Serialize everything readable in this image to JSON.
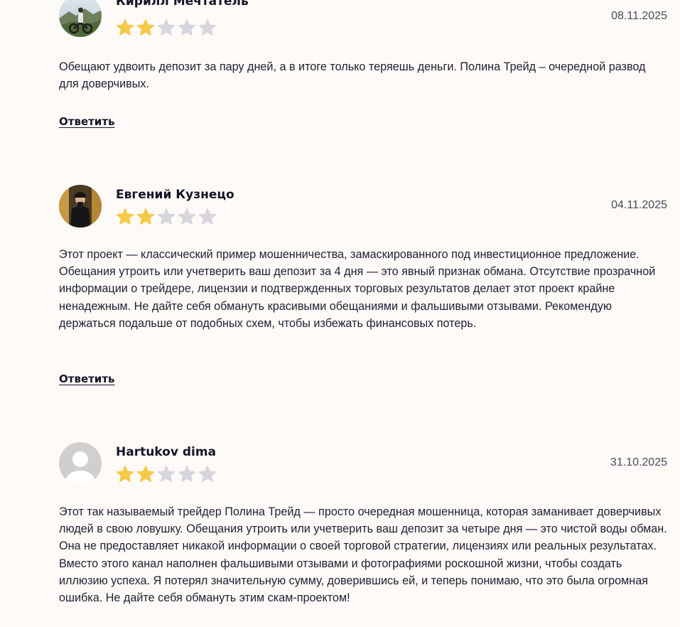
{
  "reviews": [
    {
      "author": "Кирилл Мечтатель",
      "date": "08.11.2025",
      "rating": 2,
      "rating_max": 5,
      "text": "Обещают удвоить депозит за пару дней, а в итоге только теряешь деньги. Полина Трейд – очередной развод для доверчивых.",
      "reply_label": "Ответить",
      "avatar": "photo-motorcycle"
    },
    {
      "author": "Евгений Кузнецо",
      "date": "04.11.2025",
      "rating": 2,
      "rating_max": 5,
      "text": "Этот проект — классический пример мошенничества, замаскированного под инвестиционное предложение. Обещания утроить или учетверить ваш депозит за 4 дня — это явный признак обмана. Отсутствие прозрачной информации о трейдере, лицензии и подтвержденных торговых результатов делает этот проект крайне ненадежным. Не дайте себя обмануть красивыми обещаниями и фальшивыми отзывами. Рекомендую держаться подальше от подобных схем, чтобы избежать финансовых потерь.",
      "reply_label": "Ответить",
      "avatar": "photo-mirror-selfie"
    },
    {
      "author": "Hartukov dima",
      "date": "31.10.2025",
      "rating": 2,
      "rating_max": 5,
      "text": "Этот так называемый трейдер Полина Трейд — просто очередная мошенница, которая заманивает доверчивых людей в свою ловушку. Обещания утроить или учетверить ваш депозит за четыре дня — это чистой воды обман. Она не предоставляет никакой информации о своей торговой стратегии, лицензиях или реальных результатах. Вместо этого канал наполнен фальшивыми отзывами и фотографиями роскошной жизни, чтобы создать иллюзию успеха. Я потерял значительную сумму, доверившись ей, и теперь понимаю, что это была огромная ошибка. Не дайте себя обмануть этим скам-проектом!",
      "reply_label": "",
      "avatar": "default-user"
    }
  ],
  "colors": {
    "background": "#fdfaf7",
    "star_filled": "#f7c948",
    "star_empty": "#d6d6dc",
    "text": "#1f1f33",
    "date": "#4a4a5a"
  }
}
